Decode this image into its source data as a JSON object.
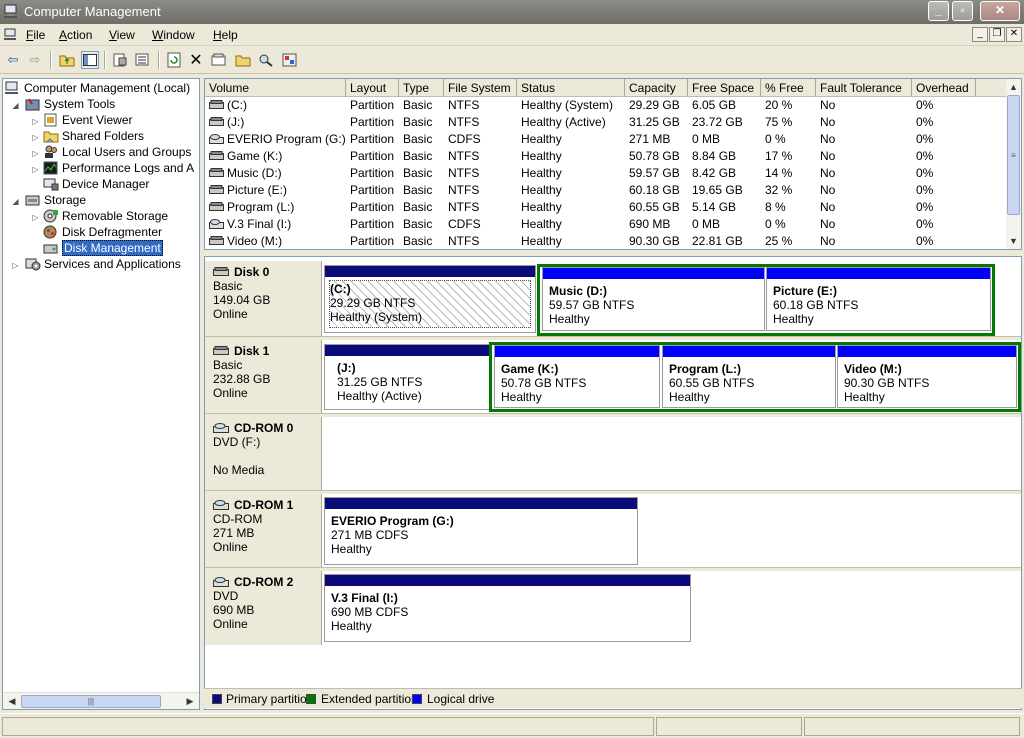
{
  "window": {
    "title": "Computer Management"
  },
  "menu": {
    "items": [
      {
        "label": "File",
        "key": "F",
        "rest": "ile"
      },
      {
        "label": "Action",
        "key": "A",
        "rest": "ction"
      },
      {
        "label": "View",
        "key": "V",
        "rest": "iew"
      },
      {
        "label": "Window",
        "key": "W",
        "rest": "indow"
      },
      {
        "label": "Help",
        "key": "H",
        "rest": "elp"
      }
    ]
  },
  "tree": {
    "root": "Computer Management (Local)",
    "system_tools": "System Tools",
    "event_viewer": "Event Viewer",
    "shared_folders": "Shared Folders",
    "local_users": "Local Users and Groups",
    "perf_logs": "Performance Logs and A",
    "device_manager": "Device Manager",
    "storage": "Storage",
    "removable_storage": "Removable Storage",
    "disk_defrag": "Disk Defragmenter",
    "disk_management": "Disk Management",
    "services": "Services and Applications"
  },
  "volumes": {
    "columns": [
      "Volume",
      "Layout",
      "Type",
      "File System",
      "Status",
      "Capacity",
      "Free Space",
      "% Free",
      "Fault Tolerance",
      "Overhead"
    ],
    "rows": [
      {
        "volume": "(C:)",
        "layout": "Partition",
        "type": "Basic",
        "fs": "NTFS",
        "status": "Healthy (System)",
        "capacity": "29.29 GB",
        "free": "6.05 GB",
        "pct": "20 %",
        "fault": "No",
        "overhead": "0%",
        "icon": "disk-icon"
      },
      {
        "volume": "(J:)",
        "layout": "Partition",
        "type": "Basic",
        "fs": "NTFS",
        "status": "Healthy (Active)",
        "capacity": "31.25 GB",
        "free": "23.72 GB",
        "pct": "75 %",
        "fault": "No",
        "overhead": "0%",
        "icon": "disk-icon"
      },
      {
        "volume": "EVERIO Program (G:)",
        "layout": "Partition",
        "type": "Basic",
        "fs": "CDFS",
        "status": "Healthy",
        "capacity": "271 MB",
        "free": "0 MB",
        "pct": "0 %",
        "fault": "No",
        "overhead": "0%",
        "icon": "cdrom-icon"
      },
      {
        "volume": "Game (K:)",
        "layout": "Partition",
        "type": "Basic",
        "fs": "NTFS",
        "status": "Healthy",
        "capacity": "50.78 GB",
        "free": "8.84 GB",
        "pct": "17 %",
        "fault": "No",
        "overhead": "0%",
        "icon": "disk-icon"
      },
      {
        "volume": "Music (D:)",
        "layout": "Partition",
        "type": "Basic",
        "fs": "NTFS",
        "status": "Healthy",
        "capacity": "59.57 GB",
        "free": "8.42 GB",
        "pct": "14 %",
        "fault": "No",
        "overhead": "0%",
        "icon": "disk-icon"
      },
      {
        "volume": "Picture (E:)",
        "layout": "Partition",
        "type": "Basic",
        "fs": "NTFS",
        "status": "Healthy",
        "capacity": "60.18 GB",
        "free": "19.65 GB",
        "pct": "32 %",
        "fault": "No",
        "overhead": "0%",
        "icon": "disk-icon"
      },
      {
        "volume": "Program (L:)",
        "layout": "Partition",
        "type": "Basic",
        "fs": "NTFS",
        "status": "Healthy",
        "capacity": "60.55 GB",
        "free": "5.14 GB",
        "pct": "8 %",
        "fault": "No",
        "overhead": "0%",
        "icon": "disk-icon"
      },
      {
        "volume": "V.3 Final (I:)",
        "layout": "Partition",
        "type": "Basic",
        "fs": "CDFS",
        "status": "Healthy",
        "capacity": "690 MB",
        "free": "0 MB",
        "pct": "0 %",
        "fault": "No",
        "overhead": "0%",
        "icon": "cdrom-icon"
      },
      {
        "volume": "Video (M:)",
        "layout": "Partition",
        "type": "Basic",
        "fs": "NTFS",
        "status": "Healthy",
        "capacity": "90.30 GB",
        "free": "22.81 GB",
        "pct": "25 %",
        "fault": "No",
        "overhead": "0%",
        "icon": "disk-icon"
      }
    ]
  },
  "disks": {
    "disk0": {
      "name": "Disk 0",
      "type": "Basic",
      "size": "149.04 GB",
      "state": "Online"
    },
    "disk1": {
      "name": "Disk 1",
      "type": "Basic",
      "size": "232.88 GB",
      "state": "Online"
    },
    "cdrom0": {
      "name": "CD-ROM 0",
      "type": "DVD (F:)",
      "state": "No Media"
    },
    "cdrom1": {
      "name": "CD-ROM 1",
      "type": "CD-ROM",
      "size": "271 MB",
      "state": "Online"
    },
    "cdrom2": {
      "name": "CD-ROM 2",
      "type": "DVD",
      "size": "690 MB",
      "state": "Online"
    }
  },
  "partitions": {
    "c": {
      "title": "(C:)",
      "size": "29.29 GB NTFS",
      "status": "Healthy (System)"
    },
    "d": {
      "title": "Music  (D:)",
      "size": "59.57 GB NTFS",
      "status": "Healthy"
    },
    "e": {
      "title": "Picture  (E:)",
      "size": "60.18 GB NTFS",
      "status": "Healthy"
    },
    "j": {
      "title": "(J:)",
      "size": "31.25 GB NTFS",
      "status": "Healthy (Active)"
    },
    "k": {
      "title": "Game  (K:)",
      "size": "50.78 GB NTFS",
      "status": "Healthy"
    },
    "l": {
      "title": "Program  (L:)",
      "size": "60.55 GB NTFS",
      "status": "Healthy"
    },
    "m": {
      "title": "Video  (M:)",
      "size": "90.30 GB NTFS",
      "status": "Healthy"
    },
    "g": {
      "title": "EVERIO Program  (G:)",
      "size": "271 MB CDFS",
      "status": "Healthy"
    },
    "i": {
      "title": "V.3 Final  (I:)",
      "size": "690 MB CDFS",
      "status": "Healthy"
    }
  },
  "legend": {
    "primary": "Primary partition",
    "extended": "Extended partition",
    "logical": "Logical drive"
  },
  "colors": {
    "primary": "#0a0a78",
    "logical": "#0000ff",
    "extended": "#007a00",
    "selection": "#316ac5"
  }
}
